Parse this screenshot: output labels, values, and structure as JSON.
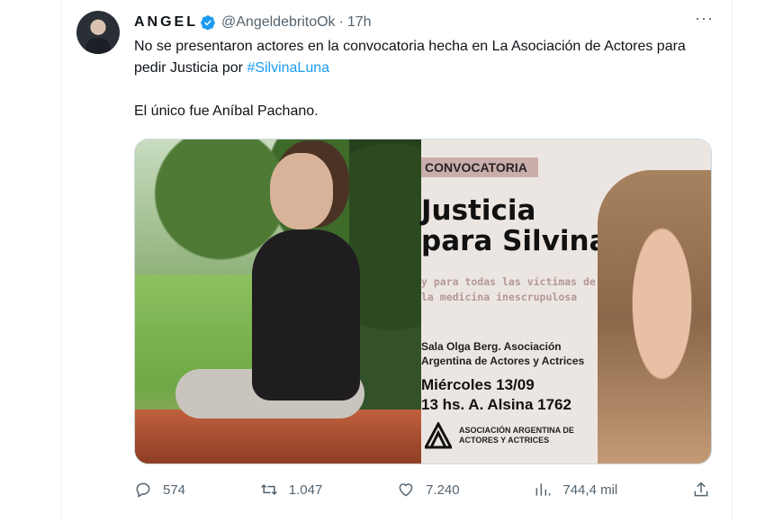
{
  "tweet": {
    "name": "ANGEL",
    "handle": "@AngeldebritoOk",
    "time": "17h",
    "more_label": "···",
    "text_line1": "No se presentaron actores en la convocatoria hecha en La Asociación de Actores para pedir Justicia por ",
    "hashtag": "#SilvinaLuna",
    "text_line2": "El único fue Aníbal Pachano."
  },
  "poster": {
    "badge": "CONVOCATORIA",
    "title_line1": "Justicia",
    "title_line2": "para Silvina",
    "sub_line1": "y para todas las víctimas de",
    "sub_line2": "la medicina inescrupulosa",
    "place_line1": "Sala Olga Berg. Asociación",
    "place_line2": "Argentina de Actores y Actrices",
    "date_line1": "Miércoles 13/09",
    "date_line2": "13 hs. A. Alsina 1762",
    "org_line1": "ASOCIACIÓN ARGENTINA DE",
    "org_line2": "ACTORES Y ACTRICES"
  },
  "actions": {
    "replies": "574",
    "retweets": "1.047",
    "likes": "7.240",
    "views": "744,4 mil"
  },
  "colors": {
    "accent": "#1d9bf0",
    "text": "#0f1419",
    "muted": "#536471"
  }
}
